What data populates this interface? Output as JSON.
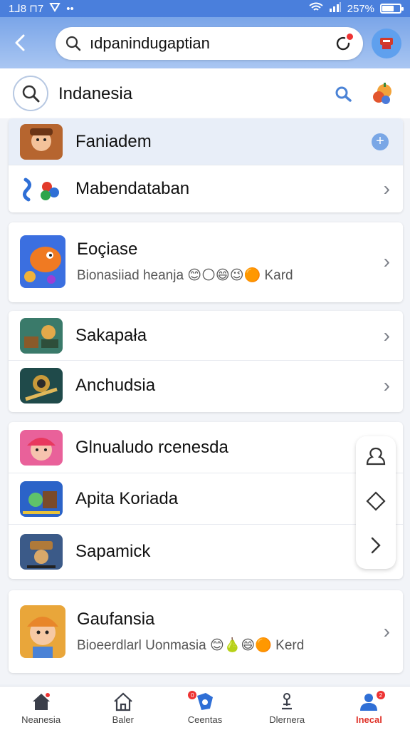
{
  "status": {
    "time": "1⅃8 ⊓7",
    "battery": "257%"
  },
  "appbar": {
    "query": "ıdpanindugaptian"
  },
  "search_row": {
    "title": "Indanesia"
  },
  "sections": [
    {
      "items": [
        {
          "label": "Faniadem",
          "highlight": true
        },
        {
          "label": "Mabendataban"
        }
      ]
    },
    {
      "items": [
        {
          "label": "Eoçiase",
          "subtitle": "Bionasiiad heanja",
          "suffix": "Kard"
        }
      ]
    },
    {
      "items": [
        {
          "label": "Sakapała"
        },
        {
          "label": "Anchudsia"
        }
      ]
    },
    {
      "items": [
        {
          "label": "Glnualudo rcenesda"
        },
        {
          "label": "Apita Koriada"
        },
        {
          "label": "Sapamick"
        }
      ]
    },
    {
      "items": [
        {
          "label": "Gaufansia",
          "subtitle": "Bioeerdlarl Uonmasia",
          "suffix": "Kerd"
        }
      ]
    }
  ],
  "bottomnav": [
    {
      "label": "Neanesia"
    },
    {
      "label": "Baler"
    },
    {
      "label": "Ceentas",
      "badge": "0"
    },
    {
      "label": "Dlernera"
    },
    {
      "label": "Inecal",
      "badge": "2",
      "active": true
    }
  ]
}
